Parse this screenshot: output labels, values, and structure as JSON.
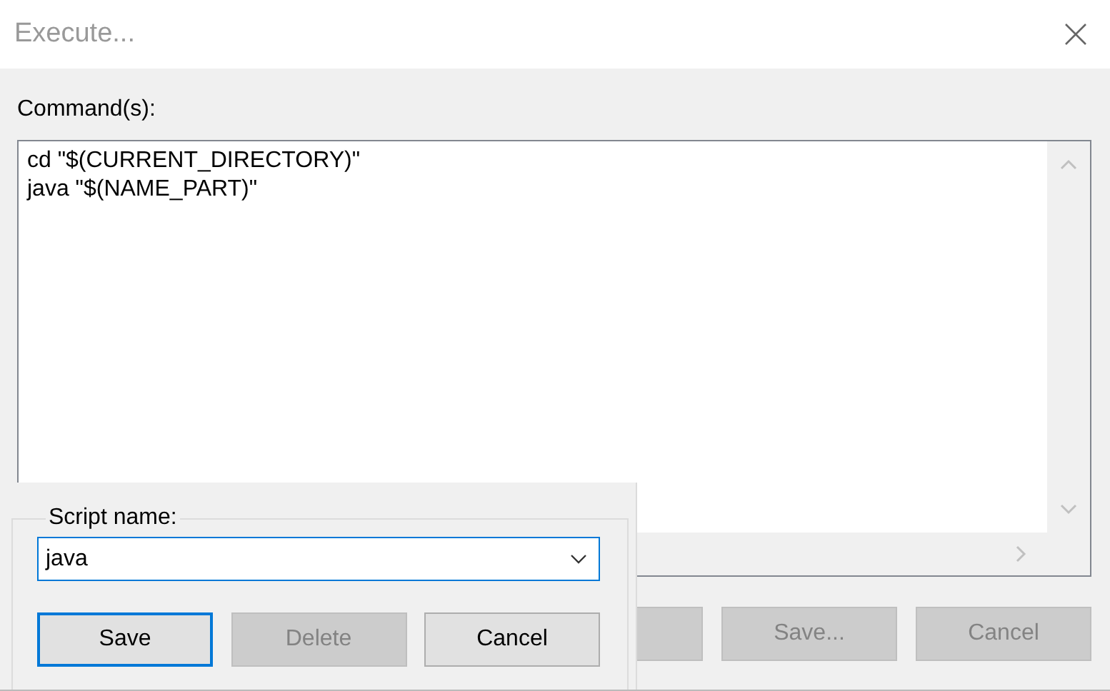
{
  "window": {
    "title": "Execute..."
  },
  "commands": {
    "label": "Command(s):",
    "lines": [
      "cd \"$(CURRENT_DIRECTORY)\"",
      "java \"$(NAME_PART)\""
    ]
  },
  "buttons": [
    {
      "label": "Save...",
      "disabled": true
    },
    {
      "label": "Cancel",
      "disabled": true
    }
  ],
  "script_popup": {
    "group_label": "Script name:",
    "combo_value": "java",
    "buttons": [
      {
        "label": "Save",
        "disabled": false,
        "focused": true
      },
      {
        "label": "Delete",
        "disabled": true,
        "focused": false
      },
      {
        "label": "Cancel",
        "disabled": false,
        "focused": false
      }
    ]
  }
}
